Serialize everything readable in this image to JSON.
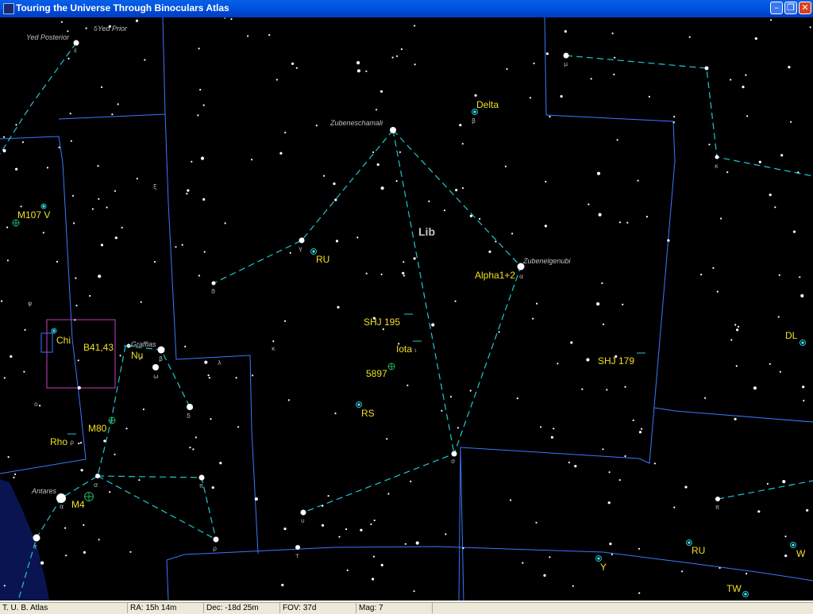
{
  "window": {
    "title": "Touring the Universe Through Binoculars Atlas",
    "controls": [
      "minimize",
      "restore",
      "close"
    ]
  },
  "status": {
    "app": "T. U. B. Atlas",
    "ra": "RA: 15h 14m",
    "dec": "Dec: -18d 25m",
    "fov": "FOV: 37d",
    "mag": "Mag: 7"
  },
  "colors": {
    "background": "#000000",
    "boundary": "#3a78ff",
    "stick_figure": "#1ec8d0",
    "label": "#f0e020",
    "star_name": "#c0c0c0",
    "selection_box": "#c040c0",
    "milky_way": "#0a1450",
    "deep_sky": "#20c080"
  },
  "constellation": {
    "abbr": "Lib"
  },
  "star_names": [
    "Yed Posterior",
    "Yed Prior",
    "Zubeneschamali",
    "Zubenelgenubi",
    "Graffias",
    "Antares"
  ],
  "object_labels": [
    "Delta",
    "RU",
    "Alpha1+2",
    "SHJ 195",
    "Iota",
    "5897",
    "RS",
    "SHJ 179",
    "DL",
    "M107 V",
    "Chi",
    "B41,43",
    "Nu",
    "M80",
    "Rho",
    "M4",
    "RU",
    "W",
    "Y",
    "TW"
  ],
  "greek_labels": [
    "δ",
    "ε",
    "μ",
    "β",
    "κ",
    "γ",
    "ϑ",
    "α",
    "ι",
    "ξ",
    "φ",
    "ο",
    "ν",
    "β",
    "λ",
    "κ",
    "ω",
    "δ",
    "σ",
    "π",
    "ρ",
    "σ",
    "τ",
    "υ",
    "α",
    "τ",
    "π",
    "ν",
    "ρ"
  ],
  "icons": [
    "star-icon",
    "double-star-icon",
    "variable-star-icon",
    "cluster-icon"
  ]
}
